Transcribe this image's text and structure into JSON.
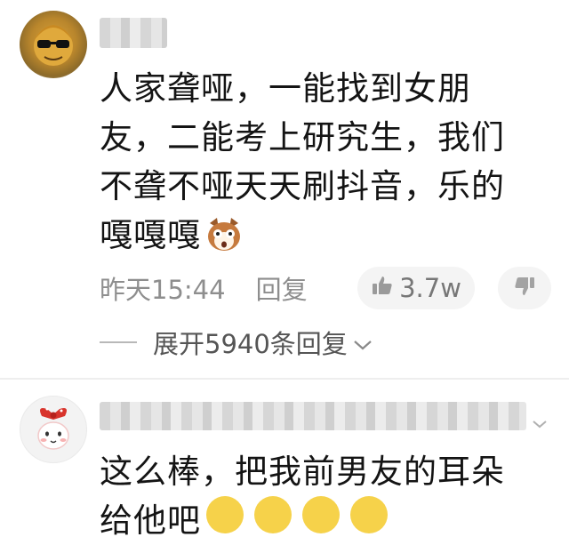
{
  "comments": [
    {
      "lines": [
        "人家聋哑，一能找到女朋",
        "友，二能考上研究生，我们",
        "不聋不哑天天刷抖音，乐的",
        "嘎嘎嘎"
      ],
      "time": "昨天15:44",
      "reply_label": "回复",
      "likes": "3.7w",
      "expand_label": "展开5940条回复",
      "icons": [
        "sunglasses-avatar",
        "dog-emoji",
        "thumbs-up-icon",
        "thumbs-down-icon",
        "chevron-down-icon"
      ]
    },
    {
      "lines": [
        "这么棒，把我前男友的耳朵",
        "给他吧"
      ],
      "icons": [
        "bow-girl-avatar",
        "smile-emoji"
      ]
    }
  ],
  "colors": {
    "text": "#141414",
    "meta": "#8e8e8e",
    "pill_bg": "#f4f4f4",
    "divider": "#eeeeee"
  }
}
